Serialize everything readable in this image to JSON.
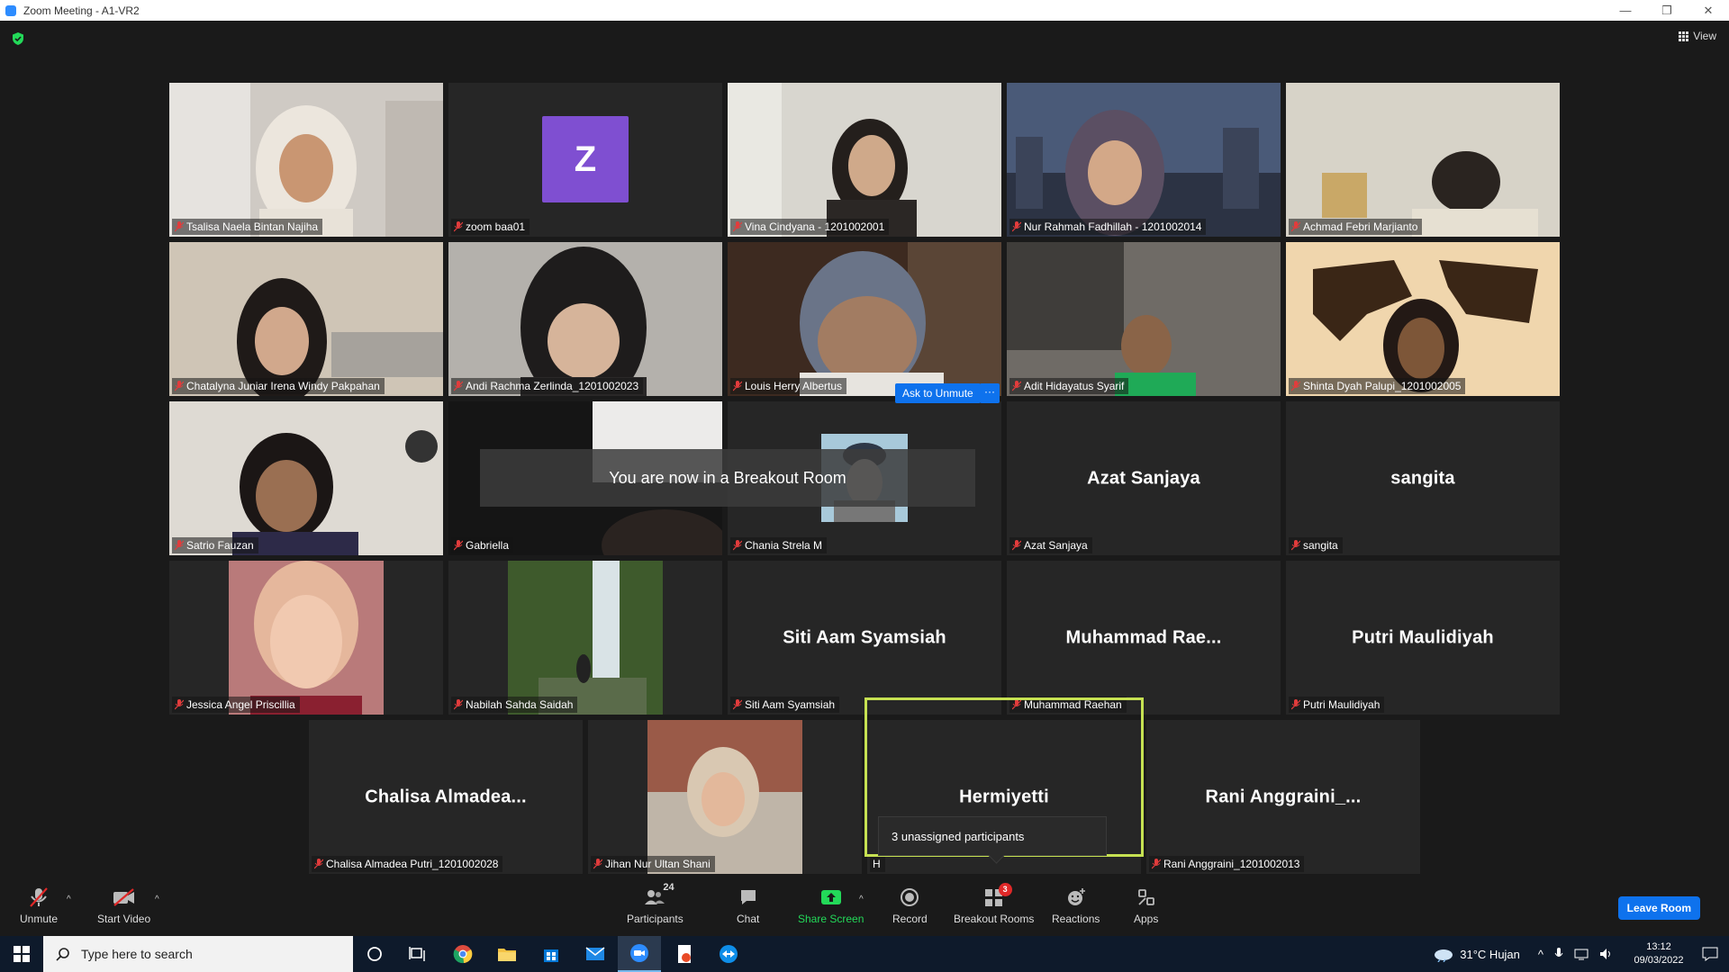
{
  "window": {
    "title": "Zoom Meeting - A1-VR2",
    "controls": [
      "—",
      "❐",
      "✕"
    ]
  },
  "header": {
    "view_label": "View"
  },
  "tiles": [
    {
      "name": "Tsalisa Naela Bintan Najiha",
      "type": "video"
    },
    {
      "name": "zoom baa01",
      "type": "avatar",
      "avatar_letter": "Z"
    },
    {
      "name": "Vina Cindyana - 1201002001",
      "type": "video"
    },
    {
      "name": "Nur Rahmah Fadhillah - 1201002014",
      "type": "video"
    },
    {
      "name": "Achmad Febri Marjianto",
      "type": "video"
    },
    {
      "name": "Chatalyna Juniar Irena Windy Pakpahan",
      "type": "video"
    },
    {
      "name": "Andi Rachma Zerlinda_1201002023",
      "type": "video"
    },
    {
      "name": "Louis Herry Albertus",
      "type": "video"
    },
    {
      "name": "Adit Hidayatus Syarif",
      "type": "video"
    },
    {
      "name": "Shinta Dyah Palupi_1201002005",
      "type": "video"
    },
    {
      "name": "Satrio Fauzan",
      "type": "video"
    },
    {
      "name": "Gabriella",
      "type": "video"
    },
    {
      "name": "Chania Strela M",
      "type": "picture"
    },
    {
      "name": "Azat Sanjaya",
      "type": "name",
      "display_name": "Azat Sanjaya"
    },
    {
      "name": "sangita",
      "type": "name",
      "display_name": "sangita"
    },
    {
      "name": "Jessica Angel Priscillia",
      "type": "picture"
    },
    {
      "name": "Nabilah Sahda Saidah",
      "type": "picture"
    },
    {
      "name": "Siti Aam Syamsiah",
      "type": "name",
      "display_name": "Siti Aam Syamsiah"
    },
    {
      "name": "Muhammad Raehan",
      "type": "name",
      "display_name": "Muhammad  Rae..."
    },
    {
      "name": "Putri Maulidiyah",
      "type": "name",
      "display_name": "Putri Maulidiyah"
    },
    {
      "name": "Chalisa Almadea Putri_1201002028",
      "type": "name",
      "display_name": "Chalisa  Almadea..."
    },
    {
      "name": "Jihan Nur Ultan Shani",
      "type": "picture"
    },
    {
      "name": "H",
      "type": "name",
      "display_name": "Hermiyetti"
    },
    {
      "name": "Rani Anggraini_1201002013",
      "type": "name",
      "display_name": "Rani  Anggraini_..."
    }
  ],
  "overlays": {
    "ask_to_unmute": "Ask to Unmute",
    "more": "···",
    "breakout_toast": "You are now in a Breakout Room",
    "unassigned_tip": "3 unassigned participants"
  },
  "toolbar": {
    "unmute": "Unmute",
    "start_video": "Start Video",
    "participants": "Participants",
    "participants_count": "24",
    "chat": "Chat",
    "share_screen": "Share Screen",
    "record": "Record",
    "breakout_rooms": "Breakout Rooms",
    "breakout_badge": "3",
    "reactions": "Reactions",
    "apps": "Apps",
    "leave_room": "Leave Room",
    "colors": {
      "accent": "#0e72ed",
      "share": "#23d959",
      "speaker": "#c6e152"
    }
  },
  "taskbar": {
    "search_placeholder": "Type here to search",
    "weather": "31°C  Hujan",
    "time": "13:12",
    "date": "09/03/2022"
  }
}
